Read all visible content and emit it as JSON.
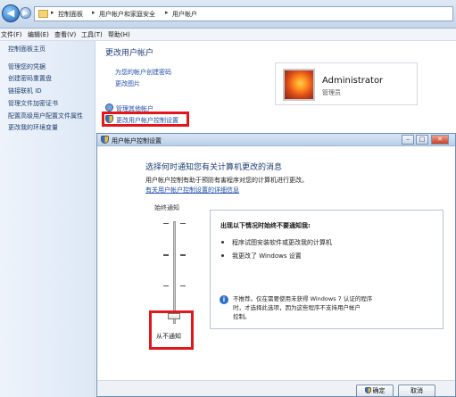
{
  "address": {
    "crumbs": [
      "控制面板",
      "用户帐户和家庭安全",
      "用户帐户"
    ]
  },
  "menubar": {
    "items": [
      "文件(F)",
      "编辑(E)",
      "查看(V)",
      "工具(T)",
      "帮助(H)"
    ]
  },
  "left_pane": {
    "items": [
      "控制面板主页",
      "管理您的凭据",
      "创建密码重置盘",
      "链接联机 ID",
      "管理文件加密证书",
      "配置高级用户配置文件属性",
      "更改我的环境变量"
    ]
  },
  "main": {
    "title": "更改用户帐户",
    "link_create_password": "为您的帐户创建密码",
    "link_change_picture": "更改图片",
    "link_manage_other": "管理其他帐户",
    "link_uac_settings": "更改用户帐户控制设置"
  },
  "user": {
    "name": "Administrator",
    "role": "管理员"
  },
  "uac_dialog": {
    "title": "用户帐户控制设置",
    "heading": "选择何时通知您有关计算机更改的消息",
    "description": "用户帐户控制有助于预防有害程序对您的计算机进行更改。",
    "learn_more_link": "有关用户帐户控制设置的详细信息",
    "slider_top_label": "始终通知",
    "slider_bottom_label": "从不通知",
    "slider_level": 0,
    "info_heading": "出现以下情况时始终不要通知我:",
    "info_items": [
      "程序试图安装软件或更改我的计算机",
      "我更改了 Windows 设置"
    ],
    "info_note_lines": [
      "不推荐。仅在需要使用未获得 Windows 7 认证的程序",
      "时，才选择此选项，因为这些程序不支持用户帐户",
      "控制。"
    ],
    "ok_label": "确定",
    "cancel_label": "取消"
  },
  "colors": {
    "highlight": "#e3161c",
    "link": "#1e4ea8",
    "heading": "#1e3d74"
  }
}
